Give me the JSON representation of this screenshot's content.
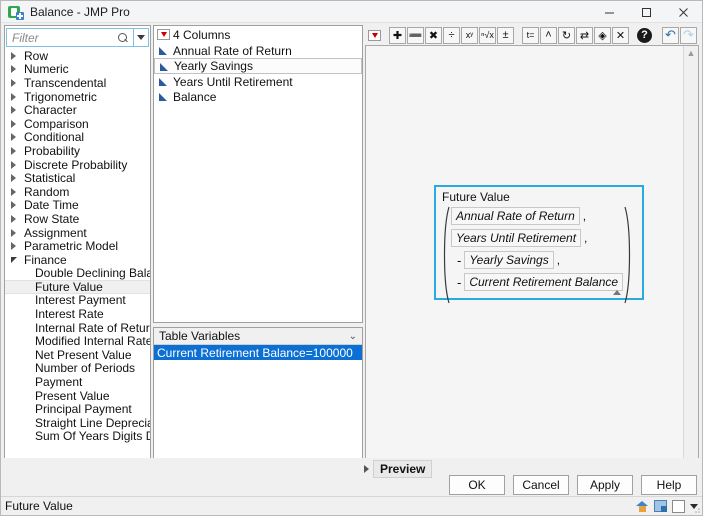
{
  "window": {
    "title": "Balance - JMP Pro",
    "app_icon": "jmp-icon",
    "minimize_label": "─",
    "maximize_label": "☐",
    "close_label": "✕"
  },
  "filter": {
    "placeholder": "Filter",
    "value": "",
    "search_icon": "search-icon",
    "dropdown_icon": "chevron-down-icon"
  },
  "function_tree": {
    "groups": [
      {
        "label": "Row",
        "expanded": false
      },
      {
        "label": "Numeric",
        "expanded": false
      },
      {
        "label": "Transcendental",
        "expanded": false
      },
      {
        "label": "Trigonometric",
        "expanded": false
      },
      {
        "label": "Character",
        "expanded": false
      },
      {
        "label": "Comparison",
        "expanded": false
      },
      {
        "label": "Conditional",
        "expanded": false
      },
      {
        "label": "Probability",
        "expanded": false
      },
      {
        "label": "Discrete Probability",
        "expanded": false
      },
      {
        "label": "Statistical",
        "expanded": false
      },
      {
        "label": "Random",
        "expanded": false
      },
      {
        "label": "Date Time",
        "expanded": false
      },
      {
        "label": "Row State",
        "expanded": false
      },
      {
        "label": "Assignment",
        "expanded": false
      },
      {
        "label": "Parametric Model",
        "expanded": false
      },
      {
        "label": "Finance",
        "expanded": true
      }
    ],
    "finance_items": [
      {
        "label": "Double Declining Balance",
        "selected": false
      },
      {
        "label": "Future Value",
        "selected": true
      },
      {
        "label": "Interest Payment",
        "selected": false
      },
      {
        "label": "Interest Rate",
        "selected": false
      },
      {
        "label": "Internal Rate of Return",
        "selected": false
      },
      {
        "label": "Modified Internal Rate of R",
        "selected": false
      },
      {
        "label": "Net Present Value",
        "selected": false
      },
      {
        "label": "Number of Periods",
        "selected": false
      },
      {
        "label": "Payment",
        "selected": false
      },
      {
        "label": "Present Value",
        "selected": false
      },
      {
        "label": "Principal Payment",
        "selected": false
      },
      {
        "label": "Straight Line Depreciation",
        "selected": false
      },
      {
        "label": "Sum Of Years Digits Depre",
        "selected": false
      }
    ],
    "settings_icon": "gear-icon"
  },
  "columns_panel": {
    "header": "4 Columns",
    "menu_icon": "red-triangle-menu-icon",
    "items": [
      {
        "label": "Annual Rate of Return",
        "focused": false
      },
      {
        "label": "Yearly Savings",
        "focused": true
      },
      {
        "label": "Years Until Retirement",
        "focused": false
      },
      {
        "label": "Balance",
        "focused": false
      }
    ]
  },
  "table_variables": {
    "header": "Table Variables",
    "header_icon": "chevron-down-icon",
    "items": [
      {
        "label": "Current Retirement Balance=100000",
        "selected": true
      }
    ]
  },
  "toolbar": {
    "menu_icon": "red-triangle-menu-icon",
    "buttons": [
      {
        "name": "add-button",
        "glyph": "✚",
        "title": "Add"
      },
      {
        "name": "subtract-button",
        "glyph": "➖",
        "title": "Subtract"
      },
      {
        "name": "multiply-button",
        "glyph": "✖",
        "title": "Multiply"
      },
      {
        "name": "divide-button",
        "glyph": "÷",
        "title": "Divide"
      },
      {
        "name": "exponent-button",
        "glyph": "xʸ",
        "title": "Exponent"
      },
      {
        "name": "root-button",
        "glyph": "ⁿ√x",
        "title": "Root"
      },
      {
        "name": "sign-toggle-button",
        "glyph": "±",
        "title": "Change sign"
      },
      {
        "name": "local-variable-button",
        "glyph": "t=",
        "title": "Local variable"
      },
      {
        "name": "insert-above-button",
        "glyph": "˄",
        "title": "Insert above"
      },
      {
        "name": "peel-button",
        "glyph": "↻",
        "title": "Peel expression"
      },
      {
        "name": "swap-button",
        "glyph": "⇄",
        "title": "Swap"
      },
      {
        "name": "paste-button",
        "glyph": "◈",
        "title": "Paste"
      },
      {
        "name": "delete-button",
        "glyph": "✕",
        "title": "Delete"
      },
      {
        "name": "help-button",
        "glyph": "?",
        "title": "Help"
      }
    ],
    "undo": {
      "name": "undo-button",
      "glyph": "↶",
      "enabled": true
    },
    "redo": {
      "name": "redo-button",
      "glyph": "↷",
      "enabled": false
    }
  },
  "formula": {
    "function_name": "Future Value",
    "arguments": [
      {
        "text": "Annual Rate of Return",
        "negated": false,
        "trailing_comma": true
      },
      {
        "text": "Years Until Retirement",
        "negated": false,
        "trailing_comma": true
      },
      {
        "text": "Yearly Savings",
        "negated": true,
        "trailing_comma": true
      },
      {
        "text": "Current Retirement Balance",
        "negated": true,
        "trailing_comma": false
      }
    ],
    "negate_symbol": "-",
    "comma_symbol": ",",
    "selection_color": "#29abe2"
  },
  "footer": {
    "preview_label": "Preview",
    "preview_expand_icon": "triangle-right-icon",
    "buttons": [
      {
        "label": "OK",
        "name": "ok-button"
      },
      {
        "label": "Cancel",
        "name": "cancel-button"
      },
      {
        "label": "Apply",
        "name": "apply-button"
      },
      {
        "label": "Help",
        "name": "help-button"
      }
    ]
  },
  "statusbar": {
    "text": "Future Value",
    "icons": [
      "home-icon",
      "window-icon",
      "square-icon",
      "chevron-down-icon"
    ]
  }
}
